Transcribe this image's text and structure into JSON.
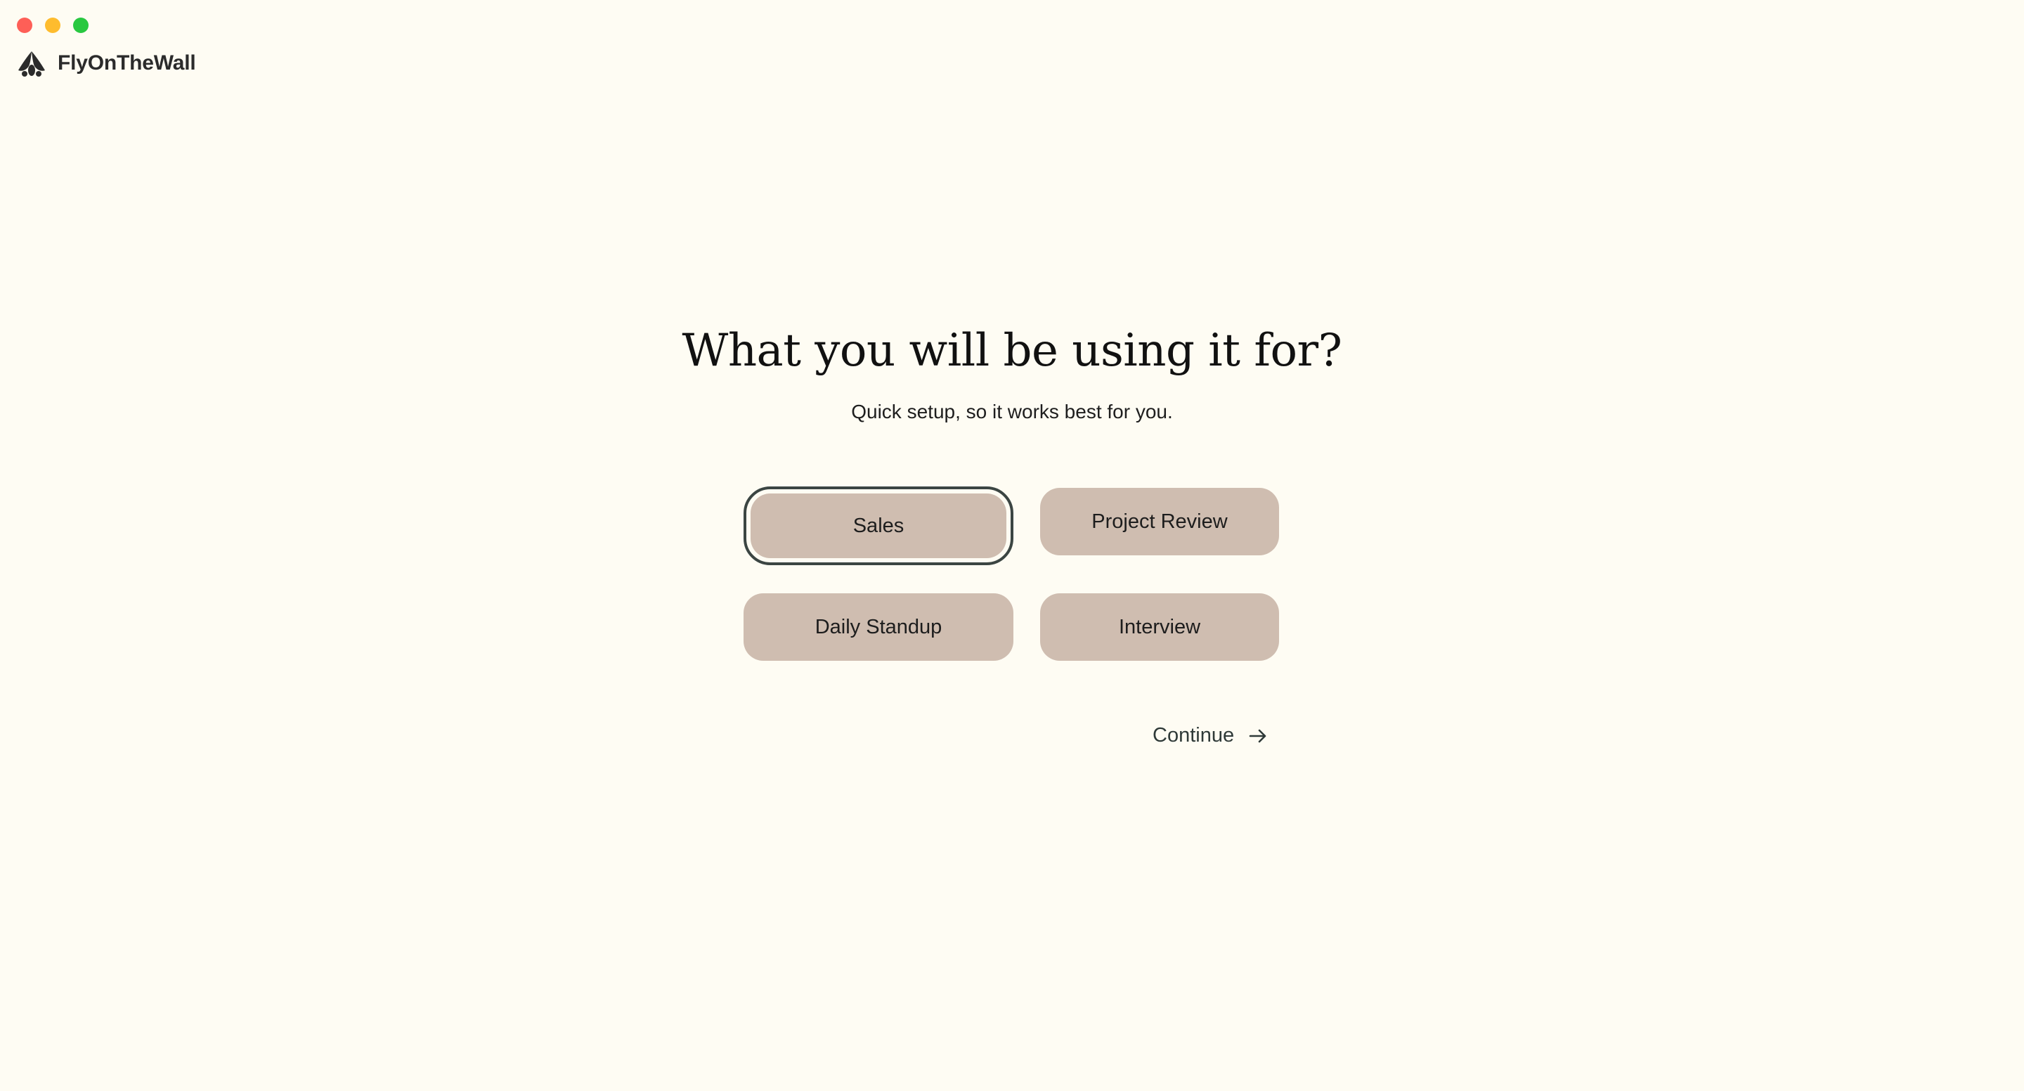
{
  "window": {
    "controls": [
      "close",
      "minimize",
      "zoom"
    ]
  },
  "brand": {
    "name": "FlyOnTheWall",
    "logo_icon": "fly-logo-icon"
  },
  "onboarding": {
    "title": "What you will be using it for?",
    "subtitle": "Quick setup, so it works best for you.",
    "options": [
      {
        "label": "Sales",
        "selected": true
      },
      {
        "label": "Project Review",
        "selected": false
      },
      {
        "label": "Daily Standup",
        "selected": false
      },
      {
        "label": "Interview",
        "selected": false
      }
    ],
    "continue_label": "Continue",
    "continue_icon": "arrow-right-icon"
  },
  "colors": {
    "background": "#fefcf3",
    "option_bg": "#cfbdb0",
    "selected_outline": "#3b4542",
    "close": "#fe5f57",
    "minimize": "#febc2e",
    "zoom": "#28c840"
  }
}
